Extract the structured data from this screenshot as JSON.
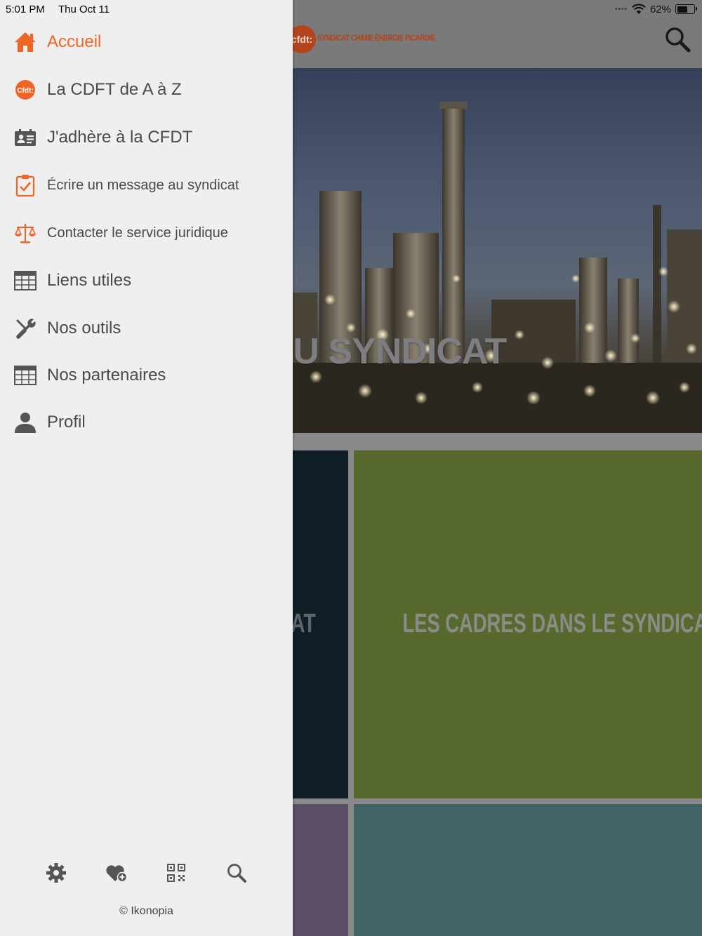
{
  "status_bar": {
    "time": "5:01 PM",
    "date": "Thu Oct 11",
    "signal_dots": "••••",
    "battery_percent": "62%",
    "battery_level": 0.62
  },
  "colors": {
    "accent": "#ef6526",
    "menu_text": "#4a4a4a",
    "drawer_bg": "#efefef",
    "icon_gray": "#555555"
  },
  "header": {
    "logo_badge": "cfdt:",
    "logo_text": "SYNDICAT CHIMIE ÉNERGIE PICARDIE",
    "search_icon": "search-icon"
  },
  "hero": {
    "title": "ÉS DU SYNDICAT"
  },
  "tiles": [
    {
      "label": "AT",
      "color": "#0f1e26"
    },
    {
      "label": "LES CADRES DANS LE SYNDICAT",
      "color": "#58692e"
    },
    {
      "label": "",
      "color": "#5d4e67"
    },
    {
      "label": "",
      "color": "#426363"
    }
  ],
  "drawer": {
    "menu": [
      {
        "label": "Accueil",
        "icon": "home-icon",
        "active": true
      },
      {
        "label": "La CDFT de A à Z",
        "icon": "cfdt-logo-icon"
      },
      {
        "label": "J'adhère à la CFDT",
        "icon": "id-card-icon"
      },
      {
        "label": "Écrire un message au syndicat",
        "icon": "clipboard-check-icon"
      },
      {
        "label": "Contacter le service juridique",
        "icon": "scales-icon"
      },
      {
        "label": "Liens utiles",
        "icon": "table-icon"
      },
      {
        "label": "Nos outils",
        "icon": "tools-icon"
      },
      {
        "label": "Nos partenaires",
        "icon": "table-icon"
      },
      {
        "label": "Profil",
        "icon": "user-icon"
      }
    ],
    "cfdt_icon_text": "Cfdt:",
    "toolbar": [
      {
        "name": "settings",
        "icon": "gear-icon"
      },
      {
        "name": "favorites",
        "icon": "heart-add-icon"
      },
      {
        "name": "qr-code",
        "icon": "qr-code-icon"
      },
      {
        "name": "search",
        "icon": "search-icon"
      }
    ],
    "copyright": "© Ikonopia"
  }
}
